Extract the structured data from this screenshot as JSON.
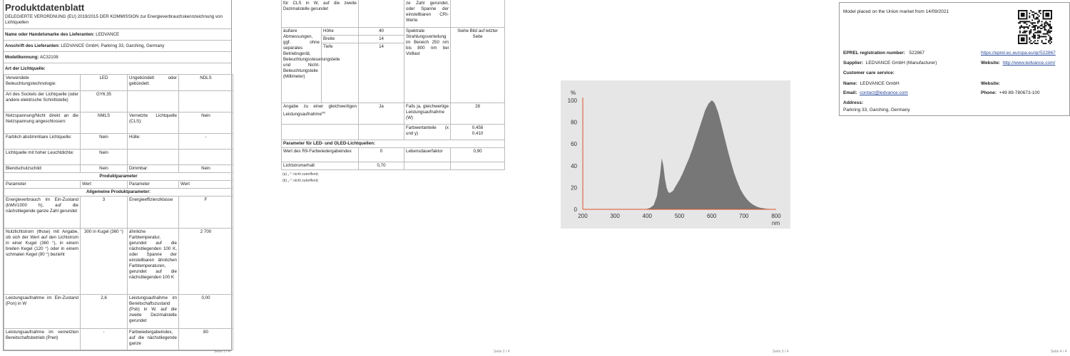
{
  "p1": {
    "title": "Produktdatenblatt",
    "subtitle": "DELEGIERTE VERORDNUNG (EU) 2019/2015 DER KOMMISSION zur Energieverbrauchskennzeichnung von Lichtquellen",
    "supplier_label": "Name oder Handelsmarke des Lieferanten:",
    "supplier_value": "LEDVANCE",
    "address_label": "Anschrift des Lieferanten:",
    "address_value": "LEDVANCE GmbH, Parkring 33, Garching, Germany",
    "model_label": "Modellkennung:",
    "model_value": "AC32108",
    "type_label": "Art der Lichtquelle:",
    "rows": [
      [
        "Verwendete Beleuchtungstechnologie:",
        "LED",
        "Ungebündelt oder gebündelt:",
        "NDLS"
      ],
      [
        "Art des Sockels der Lichtquelle (oder andere elektrische Schnittstelle)",
        "GY6.35",
        "",
        ""
      ],
      [
        "Netzspannung/Nicht direkt an die Netzspannung angeschlossen:",
        "NMLS",
        "Vernetzte Lichtquelle (CLS):",
        "Nein"
      ],
      [
        "Farblich abstimmbare Lichtquelle:",
        "Nein",
        "Hülle:",
        "-"
      ],
      [
        "Lichtquelle mit hoher Leuchtdichte:",
        "Nein",
        "",
        ""
      ],
      [
        "Blendschutzschild:",
        "Nein",
        "Dimmbar:",
        "Nein"
      ]
    ],
    "prod_params": "Produktparameter",
    "param_header": [
      "Parameter",
      "Wert",
      "Parameter",
      "Wert"
    ],
    "general_params": "Allgemeine Produktparameter:",
    "rows2": [
      [
        "Energieverbrauch im Ein-Zustand (kWh/1000 h), auf die nächstliegende ganze Zahl gerundet",
        "3",
        "Energieeffizienzklasse",
        "F"
      ],
      [
        "Nutzlichtstrom (Φuse) mit Angabe, ob sich der Wert auf den Lichtstrom in einer Kugel (360 °), in einem breiten Kegel (120 °) oder in einem schmalen Kegel (90 °) bezieht",
        "300 in Kugel (360 °)",
        "ähnliche Farbtemperatur, gerundet auf die nächstliegenden 100 K, oder Spanne der einstellbaren ähnlichen Farbtemperaturen, gerundet auf die nächstliegenden 100 K",
        "2 700"
      ],
      [
        "Leistungsaufnahme im Ein-Zustand (Pon) in W",
        "2,6",
        "Leistungsaufnahme im Bereitschaftszustand (Psb) in W, auf die zweite Dezimalstelle gerundet",
        "0,00"
      ],
      [
        "Leistungsaufnahme im vernetzten Bereitschaftsbetrieb (Pnet)",
        "-",
        "Farbwiedergabeindex, auf die nächstliegende ganze",
        "80"
      ]
    ],
    "page_no": "Seite 1 / 4"
  },
  "p2": {
    "top_left": "für CLS in W, auf die zweite Dezimalstelle gerundet",
    "top_right": "ze Zahl gerundet, oder Spanne der einstellbaren CRI-Werte",
    "dim_label": "äußere Abmessungen, ggf. ohne separates Betriebsgerät, Beleuchtungssteuerungsteile und Nicht-Beleuchtungsteile (Millimeter)",
    "dims": [
      [
        "Höhe",
        "40"
      ],
      [
        "Breite",
        "14"
      ],
      [
        "Tiefe",
        "14"
      ]
    ],
    "spectral_label": "Spektrale Strahlungsverteilung im Bereich 250 nm bis 800 nm bei Volllast",
    "spectral_value": "Siehe Bild auf letzter Seite",
    "equiv_label": "Angabe zu einer gleichwertigen Leistungsaufnahme",
    "equiv_sup": "(a)",
    "equiv_value": "Ja",
    "equiv_power_label": "Falls ja, gleichwertige Leistungsaufnahme (W)",
    "equiv_power_value": "28",
    "chroma_label": "Farbwertanteile (x und y)",
    "chroma_value1": "0,458",
    "chroma_value2": "0,410",
    "led_params": "Parameter für LED- und OLED-Lichtquellen:",
    "r9_label": "Wert des R9-Farbwiedergabeindex",
    "r9_value": "0",
    "life_label": "Lebensdauerfaktor",
    "life_value": "0,90",
    "maint_label": "Lichtstromerhalt",
    "maint_value": "0,70",
    "fn1": "(a) „-“: nicht zutreffend;",
    "fn2": "(b) „-“: nicht zutreffend;",
    "page_no": "Seite 2 / 4"
  },
  "p3": {
    "page_no": "Seite 3 / 4"
  },
  "chart_data": {
    "type": "area",
    "title": "",
    "xlabel": "nm",
    "ylabel": "%",
    "xlim": [
      200,
      800
    ],
    "ylim": [
      0,
      100
    ],
    "xticks": [
      200,
      300,
      400,
      500,
      600,
      700,
      800
    ],
    "yticks": [
      0,
      20,
      40,
      60,
      80,
      100
    ],
    "grid": false,
    "fill_color": "#777777",
    "axis_color": "#d9532a",
    "x": [
      390,
      400,
      410,
      420,
      430,
      440,
      445,
      450,
      455,
      460,
      465,
      470,
      480,
      490,
      500,
      510,
      520,
      530,
      540,
      550,
      560,
      570,
      580,
      590,
      600,
      605,
      610,
      620,
      630,
      640,
      650,
      660,
      670,
      680,
      690,
      700,
      710,
      720,
      730,
      740,
      750,
      760,
      770,
      780,
      790,
      800
    ],
    "y": [
      0,
      0.5,
      1.5,
      4,
      12,
      32,
      47,
      40,
      28,
      20,
      16,
      15,
      17,
      22,
      27,
      33,
      40,
      47,
      55,
      64,
      73,
      82,
      91,
      97,
      100,
      99,
      97,
      89,
      78,
      66,
      54,
      43,
      33,
      25,
      18,
      13,
      9,
      6,
      4,
      2.5,
      1.5,
      1,
      0.5,
      0.3,
      0.1,
      0
    ]
  },
  "p4": {
    "market_text": "Model placed on the Union market from 14/09/2021",
    "eprel_label": "EPREL registration number:",
    "eprel_value": "522867",
    "eprel_link": "https://eprel.ec.europa.eu/qr/522867",
    "supplier_label": "Supplier:",
    "supplier_value": "LEDVANCE GmbH (Manufacturer)",
    "website_label": "Website:",
    "website_value": "http://www.ledvance.com/",
    "care_label": "Customer care service:",
    "name_label": "Name:",
    "name_value": "LEDVANCE GmbH",
    "website2_label": "Website:",
    "email_label": "Email:",
    "email_value": "contact@ledvance.com",
    "phone_label": "Phone:",
    "phone_value": "+49 89-780673-100",
    "address_label": "Address:",
    "address_value": "Parkring 33, Garching, Germany",
    "page_no": "Seite 4 / 4"
  }
}
